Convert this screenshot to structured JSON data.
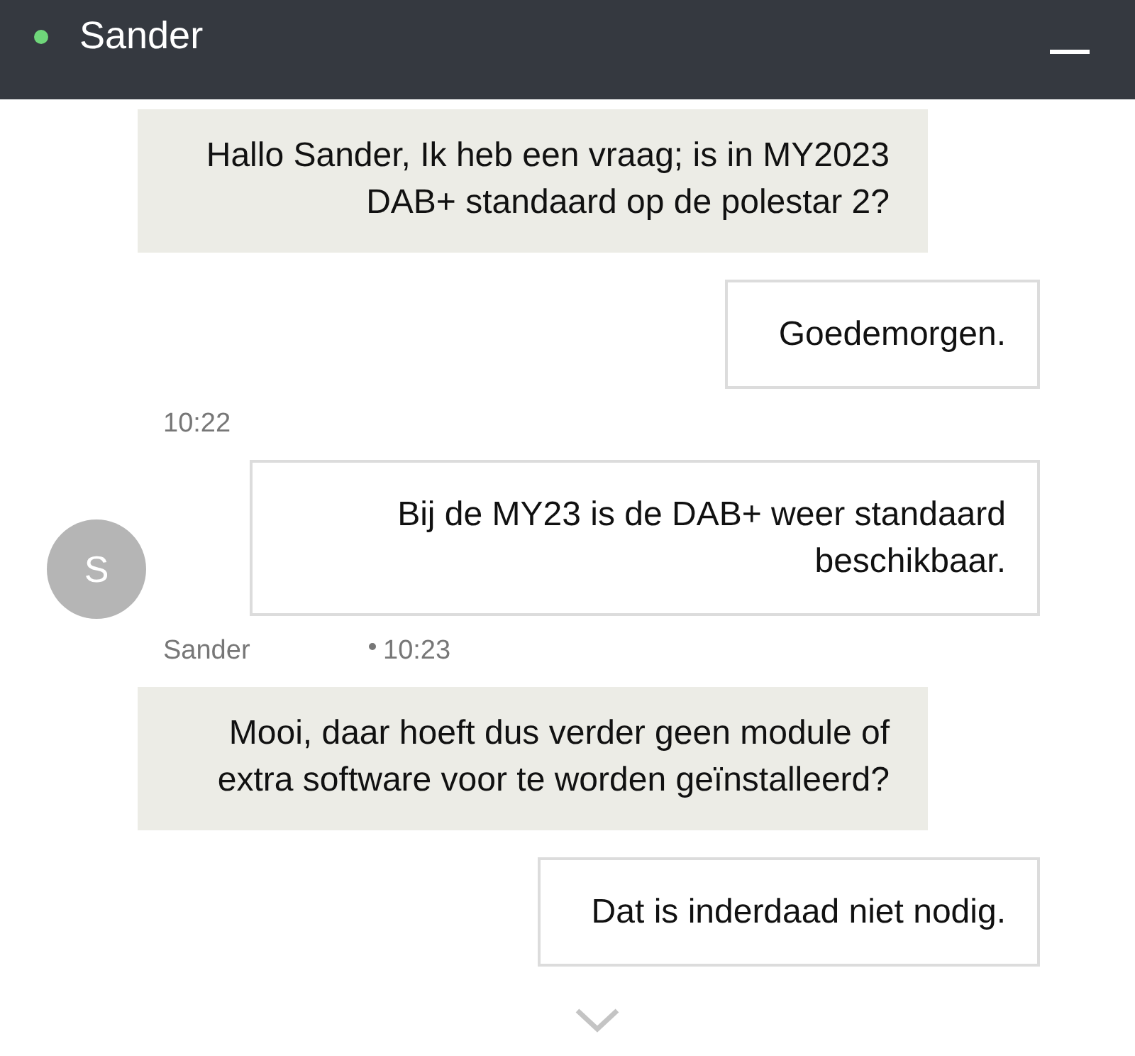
{
  "header": {
    "online": true,
    "name": "Sander"
  },
  "messages": [
    {
      "kind": "visitor",
      "text": "Hallo Sander, Ik heb een vraag; is in MY2023 DAB+ standaard op de polestar 2?"
    },
    {
      "kind": "agent",
      "text": "Goedemorgen."
    },
    {
      "kind": "time",
      "text": "10:22"
    },
    {
      "kind": "agent",
      "text": "Bij de MY23 is de DAB+ weer standaard beschikbaar.",
      "avatar": "S"
    },
    {
      "kind": "meta",
      "author": "Sander",
      "time": "10:23"
    },
    {
      "kind": "visitor",
      "text": "Mooi, daar hoeft dus verder geen module of extra software voor te worden geïnstalleerd?"
    },
    {
      "kind": "agent",
      "text": "Dat is inderdaad niet nodig."
    }
  ]
}
